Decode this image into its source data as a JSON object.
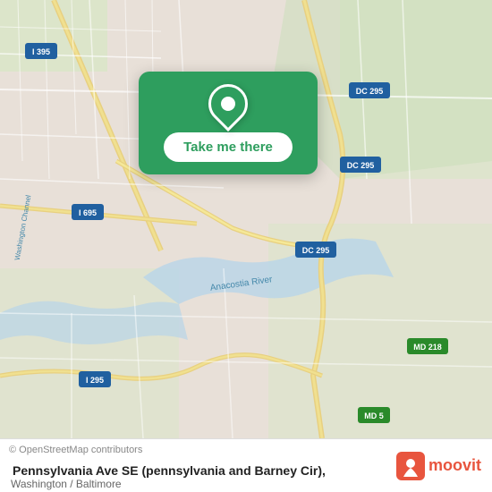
{
  "map": {
    "background_color": "#e8e0d8",
    "center_lat": 38.87,
    "center_lng": -76.98
  },
  "popup": {
    "button_label": "Take me there",
    "pin_color": "#2e9e5e"
  },
  "footer": {
    "copyright": "© OpenStreetMap contributors",
    "title": "Pennsylvania Ave SE (pennsylvania and Barney Cir),",
    "subtitle": "Washington / Baltimore",
    "logo_text": "moovit"
  }
}
